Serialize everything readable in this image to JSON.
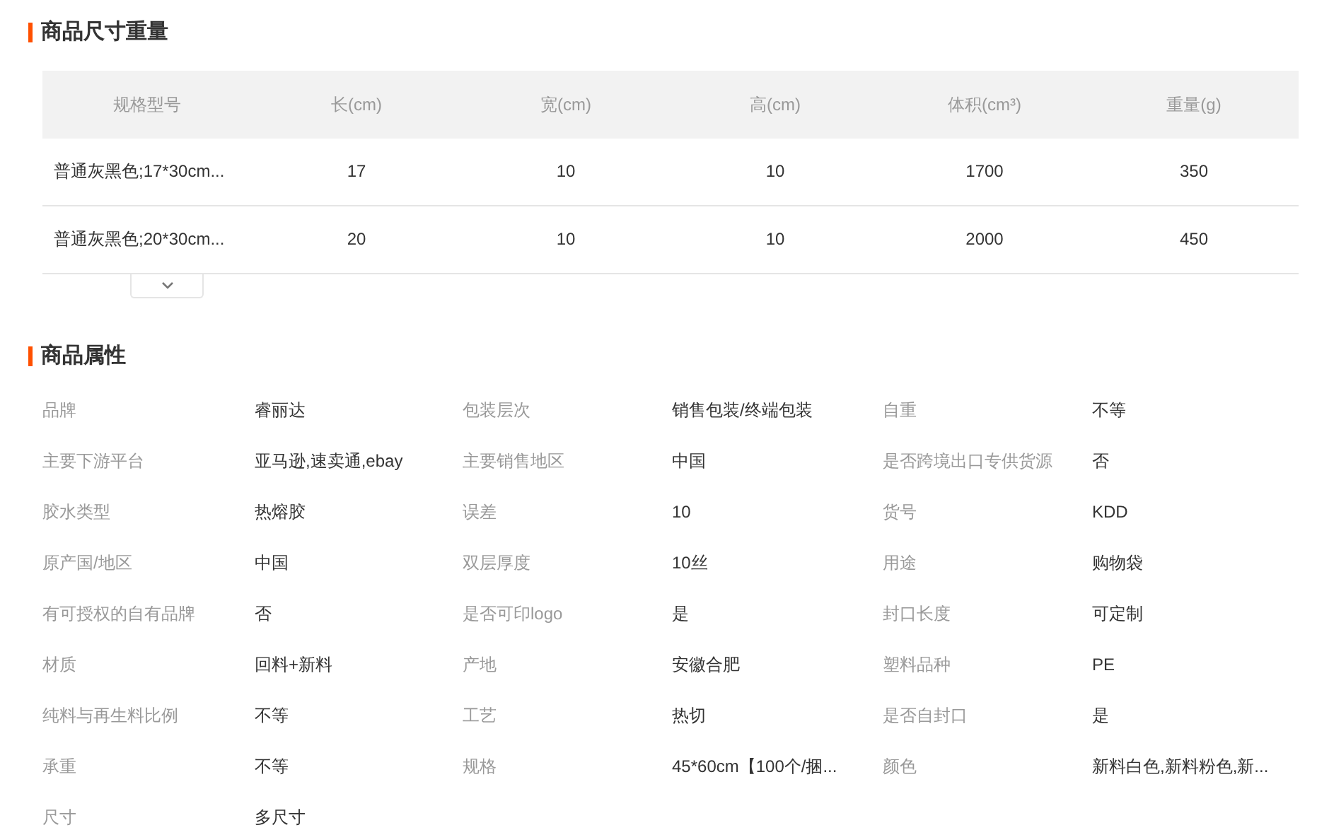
{
  "size_section": {
    "title": "商品尺寸重量",
    "columns": [
      "规格型号",
      "长(cm)",
      "宽(cm)",
      "高(cm)",
      "体积(cm³)",
      "重量(g)"
    ],
    "rows": [
      [
        "普通灰黑色;17*30cm...",
        "17",
        "10",
        "10",
        "1700",
        "350"
      ],
      [
        "普通灰黑色;20*30cm...",
        "20",
        "10",
        "10",
        "2000",
        "450"
      ]
    ],
    "expanded": false
  },
  "attributes_section": {
    "title": "商品属性",
    "attributes": [
      {
        "label": "品牌",
        "value": "睿丽达"
      },
      {
        "label": "包装层次",
        "value": "销售包装/终端包装"
      },
      {
        "label": "自重",
        "value": "不等"
      },
      {
        "label": "主要下游平台",
        "value": "亚马逊,速卖通,ebay"
      },
      {
        "label": "主要销售地区",
        "value": "中国"
      },
      {
        "label": "是否跨境出口专供货源",
        "value": "否"
      },
      {
        "label": "胶水类型",
        "value": "热熔胶"
      },
      {
        "label": "误差",
        "value": "10"
      },
      {
        "label": "货号",
        "value": "KDD"
      },
      {
        "label": "原产国/地区",
        "value": "中国"
      },
      {
        "label": "双层厚度",
        "value": "10丝"
      },
      {
        "label": "用途",
        "value": "购物袋"
      },
      {
        "label": "有可授权的自有品牌",
        "value": "否"
      },
      {
        "label": "是否可印logo",
        "value": "是"
      },
      {
        "label": "封口长度",
        "value": "可定制"
      },
      {
        "label": "材质",
        "value": "回料+新料"
      },
      {
        "label": "产地",
        "value": "安徽合肥"
      },
      {
        "label": "塑料品种",
        "value": "PE"
      },
      {
        "label": "纯料与再生料比例",
        "value": "不等"
      },
      {
        "label": "工艺",
        "value": "热切"
      },
      {
        "label": "是否自封口",
        "value": "是"
      },
      {
        "label": "承重",
        "value": "不等"
      },
      {
        "label": "规格",
        "value": "45*60cm【100个/捆..."
      },
      {
        "label": "颜色",
        "value": "新料白色,新料粉色,新..."
      },
      {
        "label": "尺寸",
        "value": "多尺寸"
      }
    ]
  }
}
